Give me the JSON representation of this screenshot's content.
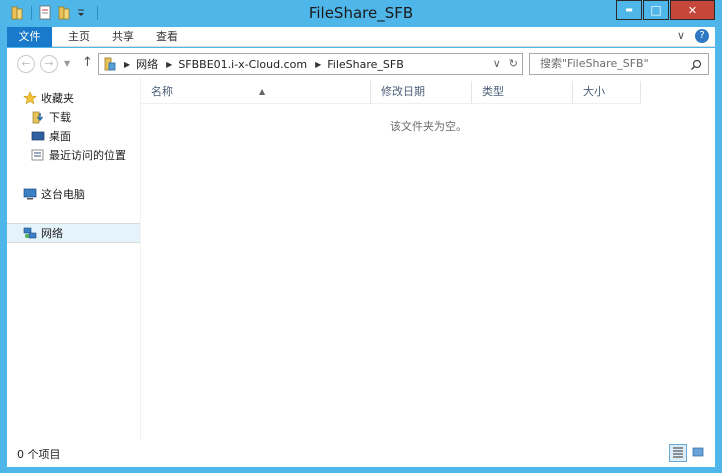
{
  "window": {
    "title": "FileShare_SFB",
    "minimize_glyph": "▬",
    "maximize_glyph": "□",
    "close_glyph": "✕"
  },
  "ribbon": {
    "tabs": [
      {
        "label": "文件"
      },
      {
        "label": "主页"
      },
      {
        "label": "共享"
      },
      {
        "label": "查看"
      }
    ],
    "expand_glyph": "∨",
    "help_glyph": "?"
  },
  "nav": {
    "back_glyph": "←",
    "forward_glyph": "→",
    "dropdown_glyph": "▼",
    "up_glyph": "↑"
  },
  "address": {
    "crumbs": [
      {
        "label": "网络"
      },
      {
        "label": "SFBBE01.i-x-Cloud.com"
      },
      {
        "label": "FileShare_SFB"
      }
    ],
    "history_glyph": "∨",
    "refresh_glyph": "↻"
  },
  "search": {
    "placeholder": "搜索\"FileShare_SFB\""
  },
  "navpane": {
    "favorites": {
      "label": "收藏夹"
    },
    "favorites_items": [
      {
        "label": "下载"
      },
      {
        "label": "桌面"
      },
      {
        "label": "最近访问的位置"
      }
    ],
    "this_pc": {
      "label": "这台电脑"
    },
    "network": {
      "label": "网络"
    }
  },
  "content": {
    "columns": [
      {
        "label": "名称"
      },
      {
        "label": "修改日期"
      },
      {
        "label": "类型"
      },
      {
        "label": "大小"
      }
    ],
    "empty_message": "该文件夹为空。"
  },
  "status": {
    "item_count": "0 个项目"
  },
  "colors": {
    "frame": "#4fb6ea",
    "file_tab": "#1979ca",
    "close_button": "#c7463b",
    "selected_nav": "#e5f3fb"
  }
}
